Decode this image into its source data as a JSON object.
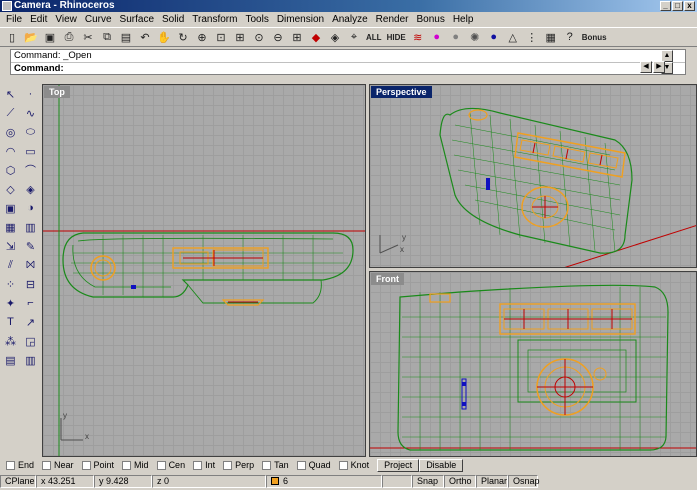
{
  "window": {
    "title": "Camera - Rhinoceros",
    "min": "_",
    "max": "□",
    "close": "x"
  },
  "menu": [
    "File",
    "Edit",
    "View",
    "Curve",
    "Surface",
    "Solid",
    "Transform",
    "Tools",
    "Dimension",
    "Analyze",
    "Render",
    "Bonus",
    "Help"
  ],
  "toolbar": {
    "all_label": "ALL",
    "hide_label": "HIDE",
    "bonus_label": "Bonus"
  },
  "command": {
    "history": "Command: _Open",
    "prompt": "Command:"
  },
  "viewports": {
    "top": {
      "title": "Top",
      "axis_x": "x",
      "axis_y": "y"
    },
    "perspective": {
      "title": "Perspective",
      "axis_x": "x",
      "axis_y": "y"
    },
    "front": {
      "title": "Front",
      "axis_x": "x",
      "axis_z": "z"
    }
  },
  "osnap": {
    "items": [
      "End",
      "Near",
      "Point",
      "Mid",
      "Cen",
      "Int",
      "Perp",
      "Tan",
      "Quad",
      "Knot"
    ],
    "project": "Project",
    "disable": "Disable"
  },
  "status": {
    "cplane": "CPlane",
    "x": "x 43.251",
    "y": "y 9.428",
    "z": "z 0",
    "layer": "6",
    "snap": "Snap",
    "ortho": "Ortho",
    "planar": "Planar",
    "osnap": "Osnap"
  },
  "colors": {
    "wire_green": "#1a8a1a",
    "highlight_orange": "#f0a020",
    "axis_red": "#c00000",
    "grid_bg": "#a9a9a9",
    "active_title": "#0a246a"
  }
}
